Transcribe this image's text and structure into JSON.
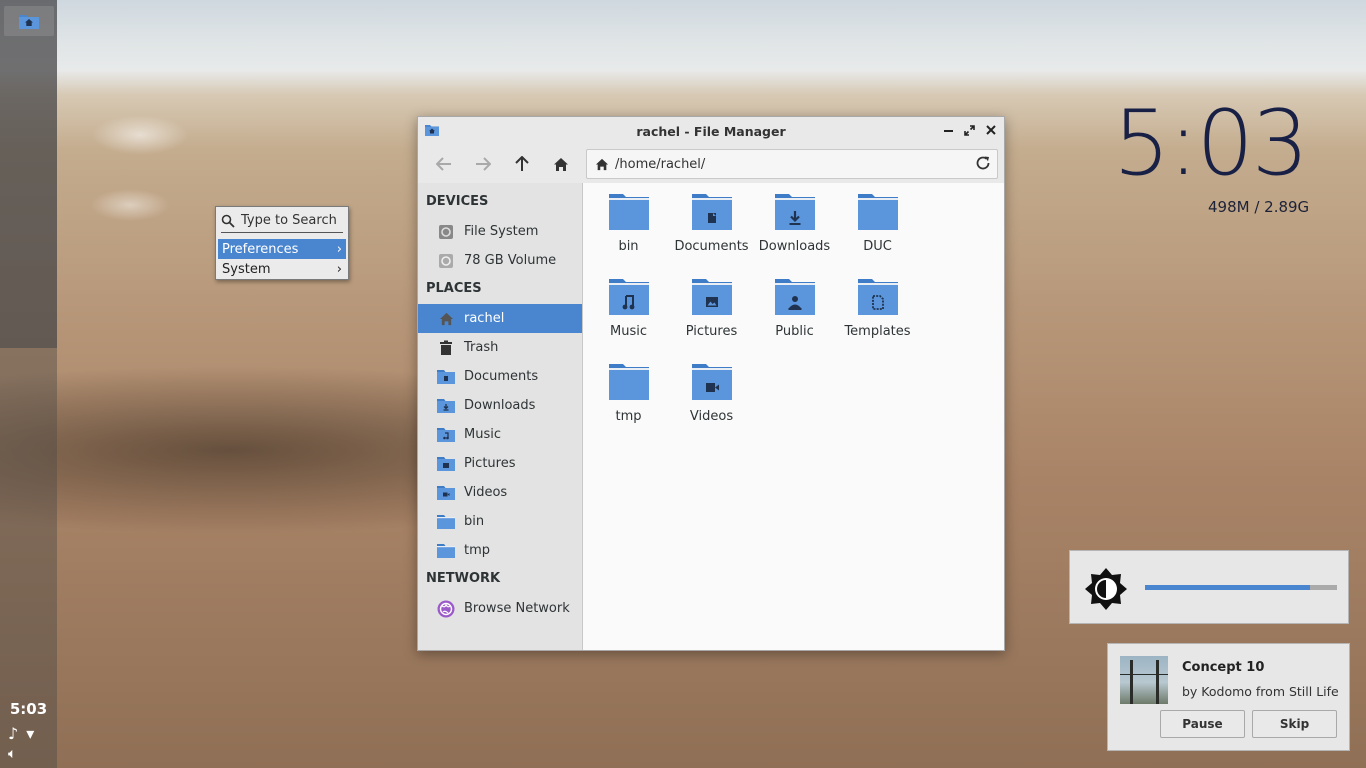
{
  "panel": {
    "launcher_icon": "home-folder-icon",
    "clock": "5:03",
    "tray_icons": [
      "music-note-icon",
      "wifi-icon",
      "volume-icon"
    ]
  },
  "context_menu": {
    "search_placeholder": "Type to Search",
    "items": [
      {
        "label": "Preferences",
        "arrow": "›",
        "selected": true
      },
      {
        "label": "System",
        "arrow": "›",
        "selected": false
      }
    ]
  },
  "window": {
    "title": "rachel - File Manager",
    "controls": {
      "minimize": "−",
      "maximize": "⤢",
      "close": "✕"
    },
    "toolbar": {
      "back": "back-arrow-icon",
      "forward": "forward-arrow-icon",
      "up": "up-arrow-icon",
      "home": "home-icon"
    },
    "location": "/home/rachel/",
    "sidebar": {
      "devices_label": "DEVICES",
      "devices": [
        {
          "label": "File System",
          "icon": "drive-icon"
        },
        {
          "label": "78 GB Volume",
          "icon": "drive-icon"
        }
      ],
      "places_label": "PLACES",
      "places": [
        {
          "label": "rachel",
          "icon": "home-icon",
          "selected": true
        },
        {
          "label": "Trash",
          "icon": "trash-icon"
        },
        {
          "label": "Documents",
          "icon": "folder-documents-icon"
        },
        {
          "label": "Downloads",
          "icon": "folder-downloads-icon"
        },
        {
          "label": "Music",
          "icon": "folder-music-icon"
        },
        {
          "label": "Pictures",
          "icon": "folder-pictures-icon"
        },
        {
          "label": "Videos",
          "icon": "folder-videos-icon"
        },
        {
          "label": "bin",
          "icon": "folder-icon"
        },
        {
          "label": "tmp",
          "icon": "folder-icon"
        }
      ],
      "network_label": "NETWORK",
      "network": [
        {
          "label": "Browse Network",
          "icon": "network-globe-icon"
        }
      ]
    },
    "files": [
      {
        "name": "bin",
        "emblem": ""
      },
      {
        "name": "Documents",
        "emblem": "document"
      },
      {
        "name": "Downloads",
        "emblem": "download"
      },
      {
        "name": "DUC",
        "emblem": ""
      },
      {
        "name": "Music",
        "emblem": "music"
      },
      {
        "name": "Pictures",
        "emblem": "picture"
      },
      {
        "name": "Public",
        "emblem": "public"
      },
      {
        "name": "Templates",
        "emblem": "template"
      },
      {
        "name": "tmp",
        "emblem": ""
      },
      {
        "name": "Videos",
        "emblem": "video"
      }
    ]
  },
  "desktop_clock": {
    "time": "5:03",
    "memory": "498M / 2.89G"
  },
  "brightness_osd": {
    "icon": "brightness-icon",
    "level": 0.86,
    "accent": "#4a86cf"
  },
  "media": {
    "title": "Concept 10",
    "subtitle": "by Kodomo from Still Life",
    "pause_label": "Pause",
    "skip_label": "Skip"
  }
}
